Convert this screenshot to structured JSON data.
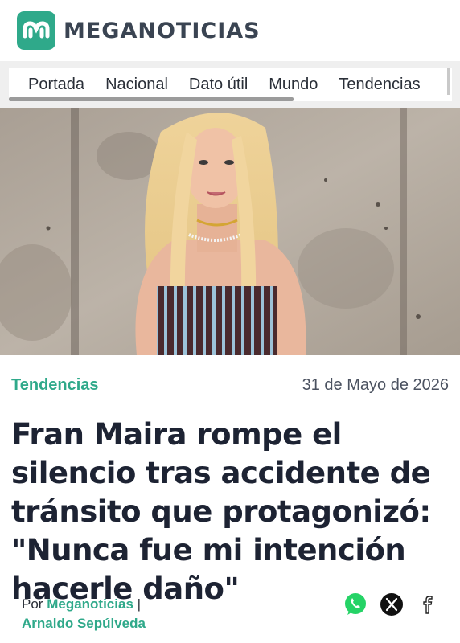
{
  "brand": {
    "name": "MEGANOTICIAS",
    "accent": "#2fa98a"
  },
  "nav": {
    "items": [
      "Portada",
      "Nacional",
      "Dato útil",
      "Mundo",
      "Tendencias"
    ]
  },
  "hero": {
    "image": "portrait-woman-blonde-striped-top"
  },
  "article": {
    "category": "Tendencias",
    "date": "31 de Mayo de 2026",
    "title": "Fran Maira rompe el silencio tras accidente de tránsito que protagonizó: \"Nunca fue mi intención hacerle daño\"",
    "byline_prefix": "Por",
    "byline_author1": "Meganoticias",
    "byline_separator": "|",
    "byline_author2": "Arnaldo Sepúlveda"
  },
  "share": {
    "icons": [
      "whatsapp-icon",
      "x-icon",
      "facebook-icon"
    ]
  }
}
